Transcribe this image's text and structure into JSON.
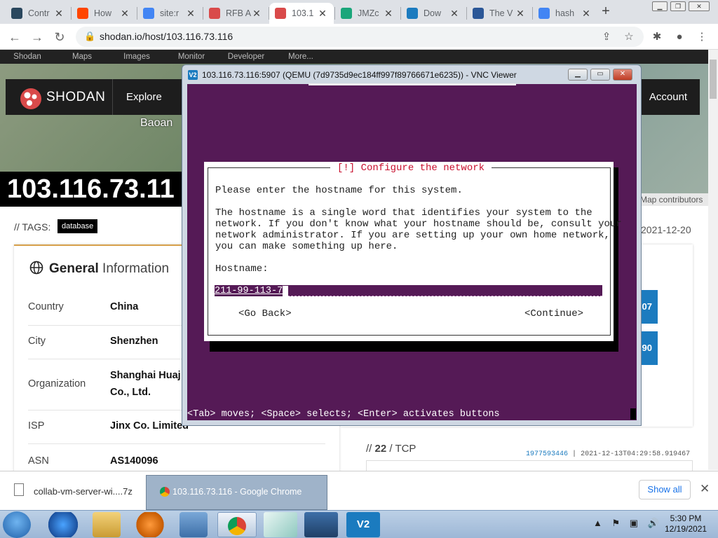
{
  "browser": {
    "tabs": [
      {
        "label": "Contr",
        "icon": "steam-icon"
      },
      {
        "label": "How",
        "icon": "reddit-icon"
      },
      {
        "label": "site:r",
        "icon": "google-icon"
      },
      {
        "label": "RFB A",
        "icon": "shodan-icon"
      },
      {
        "label": "103.1",
        "icon": "shodan-icon",
        "active": true
      },
      {
        "label": "JMZc",
        "icon": "jmz-icon"
      },
      {
        "label": "Dow",
        "icon": "vnc-icon"
      },
      {
        "label": "The V",
        "icon": "doc-icon"
      },
      {
        "label": "hash",
        "icon": "google-icon"
      }
    ],
    "url": "shodan.io/host/103.116.73.116"
  },
  "shodan": {
    "nav": [
      "Shodan",
      "Maps",
      "Images",
      "Monitor",
      "Developer",
      "More..."
    ],
    "brand": "SHODAN",
    "explore": "Explore",
    "account": "Account",
    "map_label": "Baoan",
    "ip_title": "103.116.73.11",
    "map_credit": "Map contributors",
    "tags_label": "// TAGS:",
    "tag": "database",
    "date_fragment": "2021-12-20",
    "general_title_bold": "General",
    "general_title_rest": "Information",
    "info": [
      {
        "key": "Country",
        "value": "China"
      },
      {
        "key": "City",
        "value": "Shenzhen"
      },
      {
        "key": "Organization",
        "value_line1": "Shanghai Huaj",
        "value_line2": "Co., Ltd."
      },
      {
        "key": "ISP",
        "value": "Jinx Co. Limited"
      },
      {
        "key": "ASN",
        "value": "AS140096"
      }
    ],
    "ports": [
      "07",
      "90"
    ],
    "port_line_prefix": "//",
    "port_line_num": "22",
    "port_line_proto": "/ TCP",
    "banner_hash": "1977593446",
    "banner_sep": "|",
    "banner_time": "2021-12-13T04:29:58.919467"
  },
  "vnc": {
    "title": "103.116.73.116:5907 (QEMU (7d9735d9ec184ff997f89766671e6235)) - VNC Viewer",
    "dialog_title": "[!] Configure the network",
    "line1": "Please enter the hostname for this system.",
    "para": "The hostname is a single word that identifies your system to the\nnetwork. If you don't know what your hostname should be, consult your\nnetwork administrator. If you are setting up your own home network,\nyou can make something up here.",
    "hostname_label": "Hostname:",
    "hostname_value": "211-99-113-7",
    "go_back": "<Go Back>",
    "continue": "<Continue>",
    "status": "<Tab> moves; <Space> selects; <Enter> activates buttons"
  },
  "downloads": {
    "file": "collab-vm-server-wi....7z",
    "show_all": "Show all"
  },
  "taskbar": {
    "active_window": "103.116.73.116 - Google Chrome",
    "time": "5:30 PM",
    "date": "12/19/2021"
  }
}
